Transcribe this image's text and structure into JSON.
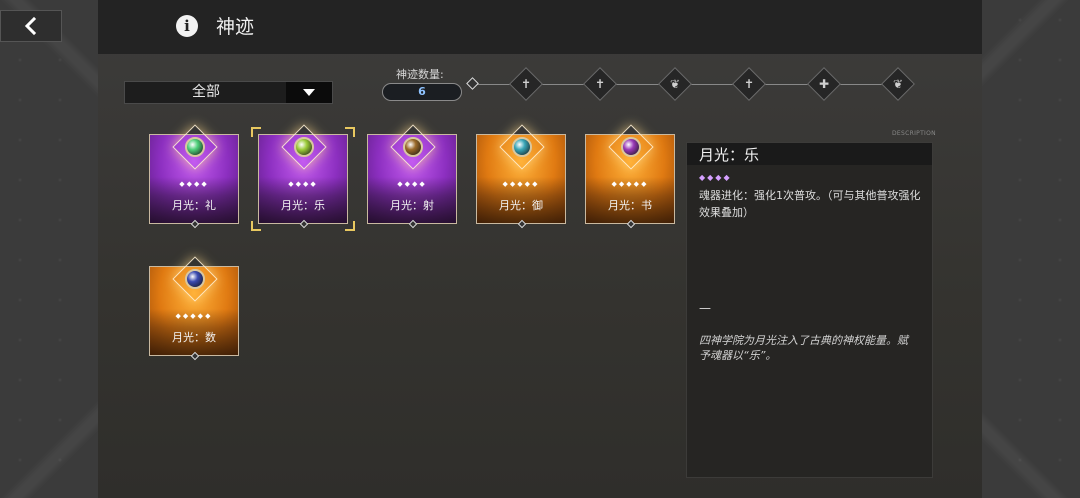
{
  "header": {
    "title": "神迹"
  },
  "filter": {
    "selected": "全部"
  },
  "count": {
    "label": "神迹数量:",
    "value": "6"
  },
  "milestones": [
    {
      "icon": "sword-icon",
      "symbol": "✝"
    },
    {
      "icon": "sword-icon",
      "symbol": "✝"
    },
    {
      "icon": "leaf-icon",
      "symbol": "❦"
    },
    {
      "icon": "sword-icon",
      "symbol": "✝"
    },
    {
      "icon": "shield-icon",
      "symbol": "✚"
    },
    {
      "icon": "leaf-icon",
      "symbol": "❦"
    }
  ],
  "description_tag": "DESCRIPTION",
  "cards": [
    {
      "name": "月光：礼",
      "rarity": "purple",
      "stars": "◆◆◆◆",
      "gem_color": "#4fd07a"
    },
    {
      "name": "月光：乐",
      "rarity": "purple",
      "stars": "◆◆◆◆",
      "gem_color": "#9ccc3a"
    },
    {
      "name": "月光：射",
      "rarity": "purple",
      "stars": "◆◆◆◆",
      "gem_color": "#9a6a2a"
    },
    {
      "name": "月光：御",
      "rarity": "orange",
      "stars": "◆◆◆◆◆",
      "gem_color": "#3aa6b8"
    },
    {
      "name": "月光：书",
      "rarity": "orange",
      "stars": "◆◆◆◆◆",
      "gem_color": "#9a3ab8"
    },
    {
      "name": "月光：数",
      "rarity": "orange",
      "stars": "◆◆◆◆◆",
      "gem_color": "#3a4ab0"
    }
  ],
  "selected_card": 1,
  "detail": {
    "title": "月光：乐",
    "stars": "◆◆◆◆",
    "effect": "魂器进化：强化1次普攻。（可与其他普攻强化效果叠加）",
    "dash": "—",
    "lore": "四神学院为月光注入了古典的神权能量。赋予魂器以“乐”。"
  }
}
